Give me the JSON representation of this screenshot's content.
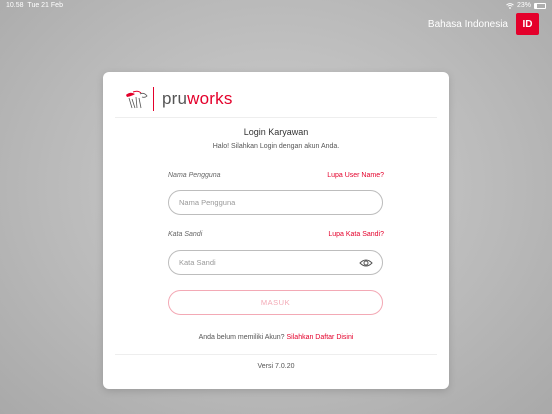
{
  "status_bar": {
    "time": "10.58",
    "date": "Tue 21 Feb",
    "battery": "23%",
    "battery_level": 0.23
  },
  "header": {
    "language_label": "Bahasa Indonesia",
    "language_code": "ID"
  },
  "logo": {
    "text_prefix": "pru",
    "text_suffix": "works"
  },
  "login": {
    "title": "Login Karyawan",
    "subtitle": "Halo! Silahkan Login dengan akun Anda.",
    "username_label": "Nama Pengguna",
    "username_forgot": "Lupa User Name?",
    "username_placeholder": "Nama Pengguna",
    "password_label": "Kata Sandi",
    "password_forgot": "Lupa Kata Sandi?",
    "password_placeholder": "Kata Sandi",
    "submit_label": "MASUK",
    "signup_prompt": "Anda belum memiliki Akun?",
    "signup_link": "Silahkan Daftar Disini",
    "version": "Versi 7.0.20"
  },
  "colors": {
    "brand_red": "#e4002b",
    "button_disabled": "#f3a9b5"
  }
}
